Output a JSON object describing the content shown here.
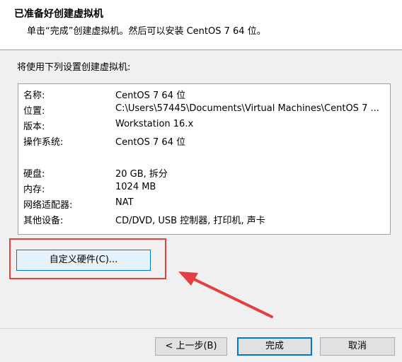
{
  "header": {
    "title": "已准备好创建虚拟机",
    "subtitle": "单击“完成”创建虚拟机。然后可以安装 CentOS 7 64 位。"
  },
  "section_label": "将使用下列设置创建虚拟机:",
  "summary": [
    {
      "key": "名称:",
      "value": "CentOS 7 64 位"
    },
    {
      "key": "位置:",
      "value": "C:\\Users\\57445\\Documents\\Virtual Machines\\CentOS 7 ..."
    },
    {
      "key": "版本:",
      "value": "Workstation 16.x"
    },
    {
      "key": "操作系统:",
      "value": "CentOS 7 64 位"
    },
    {
      "key": "",
      "value": ""
    },
    {
      "key": "硬盘:",
      "value": "20 GB, 拆分"
    },
    {
      "key": "内存:",
      "value": "1024 MB"
    },
    {
      "key": "网络适配器:",
      "value": "NAT"
    },
    {
      "key": "其他设备:",
      "value": "CD/DVD, USB 控制器, 打印机, 声卡"
    }
  ],
  "buttons": {
    "customize": "自定义硬件(C)...",
    "back": "< 上一步(B)",
    "finish": "完成",
    "cancel": "取消"
  },
  "colors": {
    "annotation": "#e53f3f",
    "focus": "#0078d7"
  }
}
